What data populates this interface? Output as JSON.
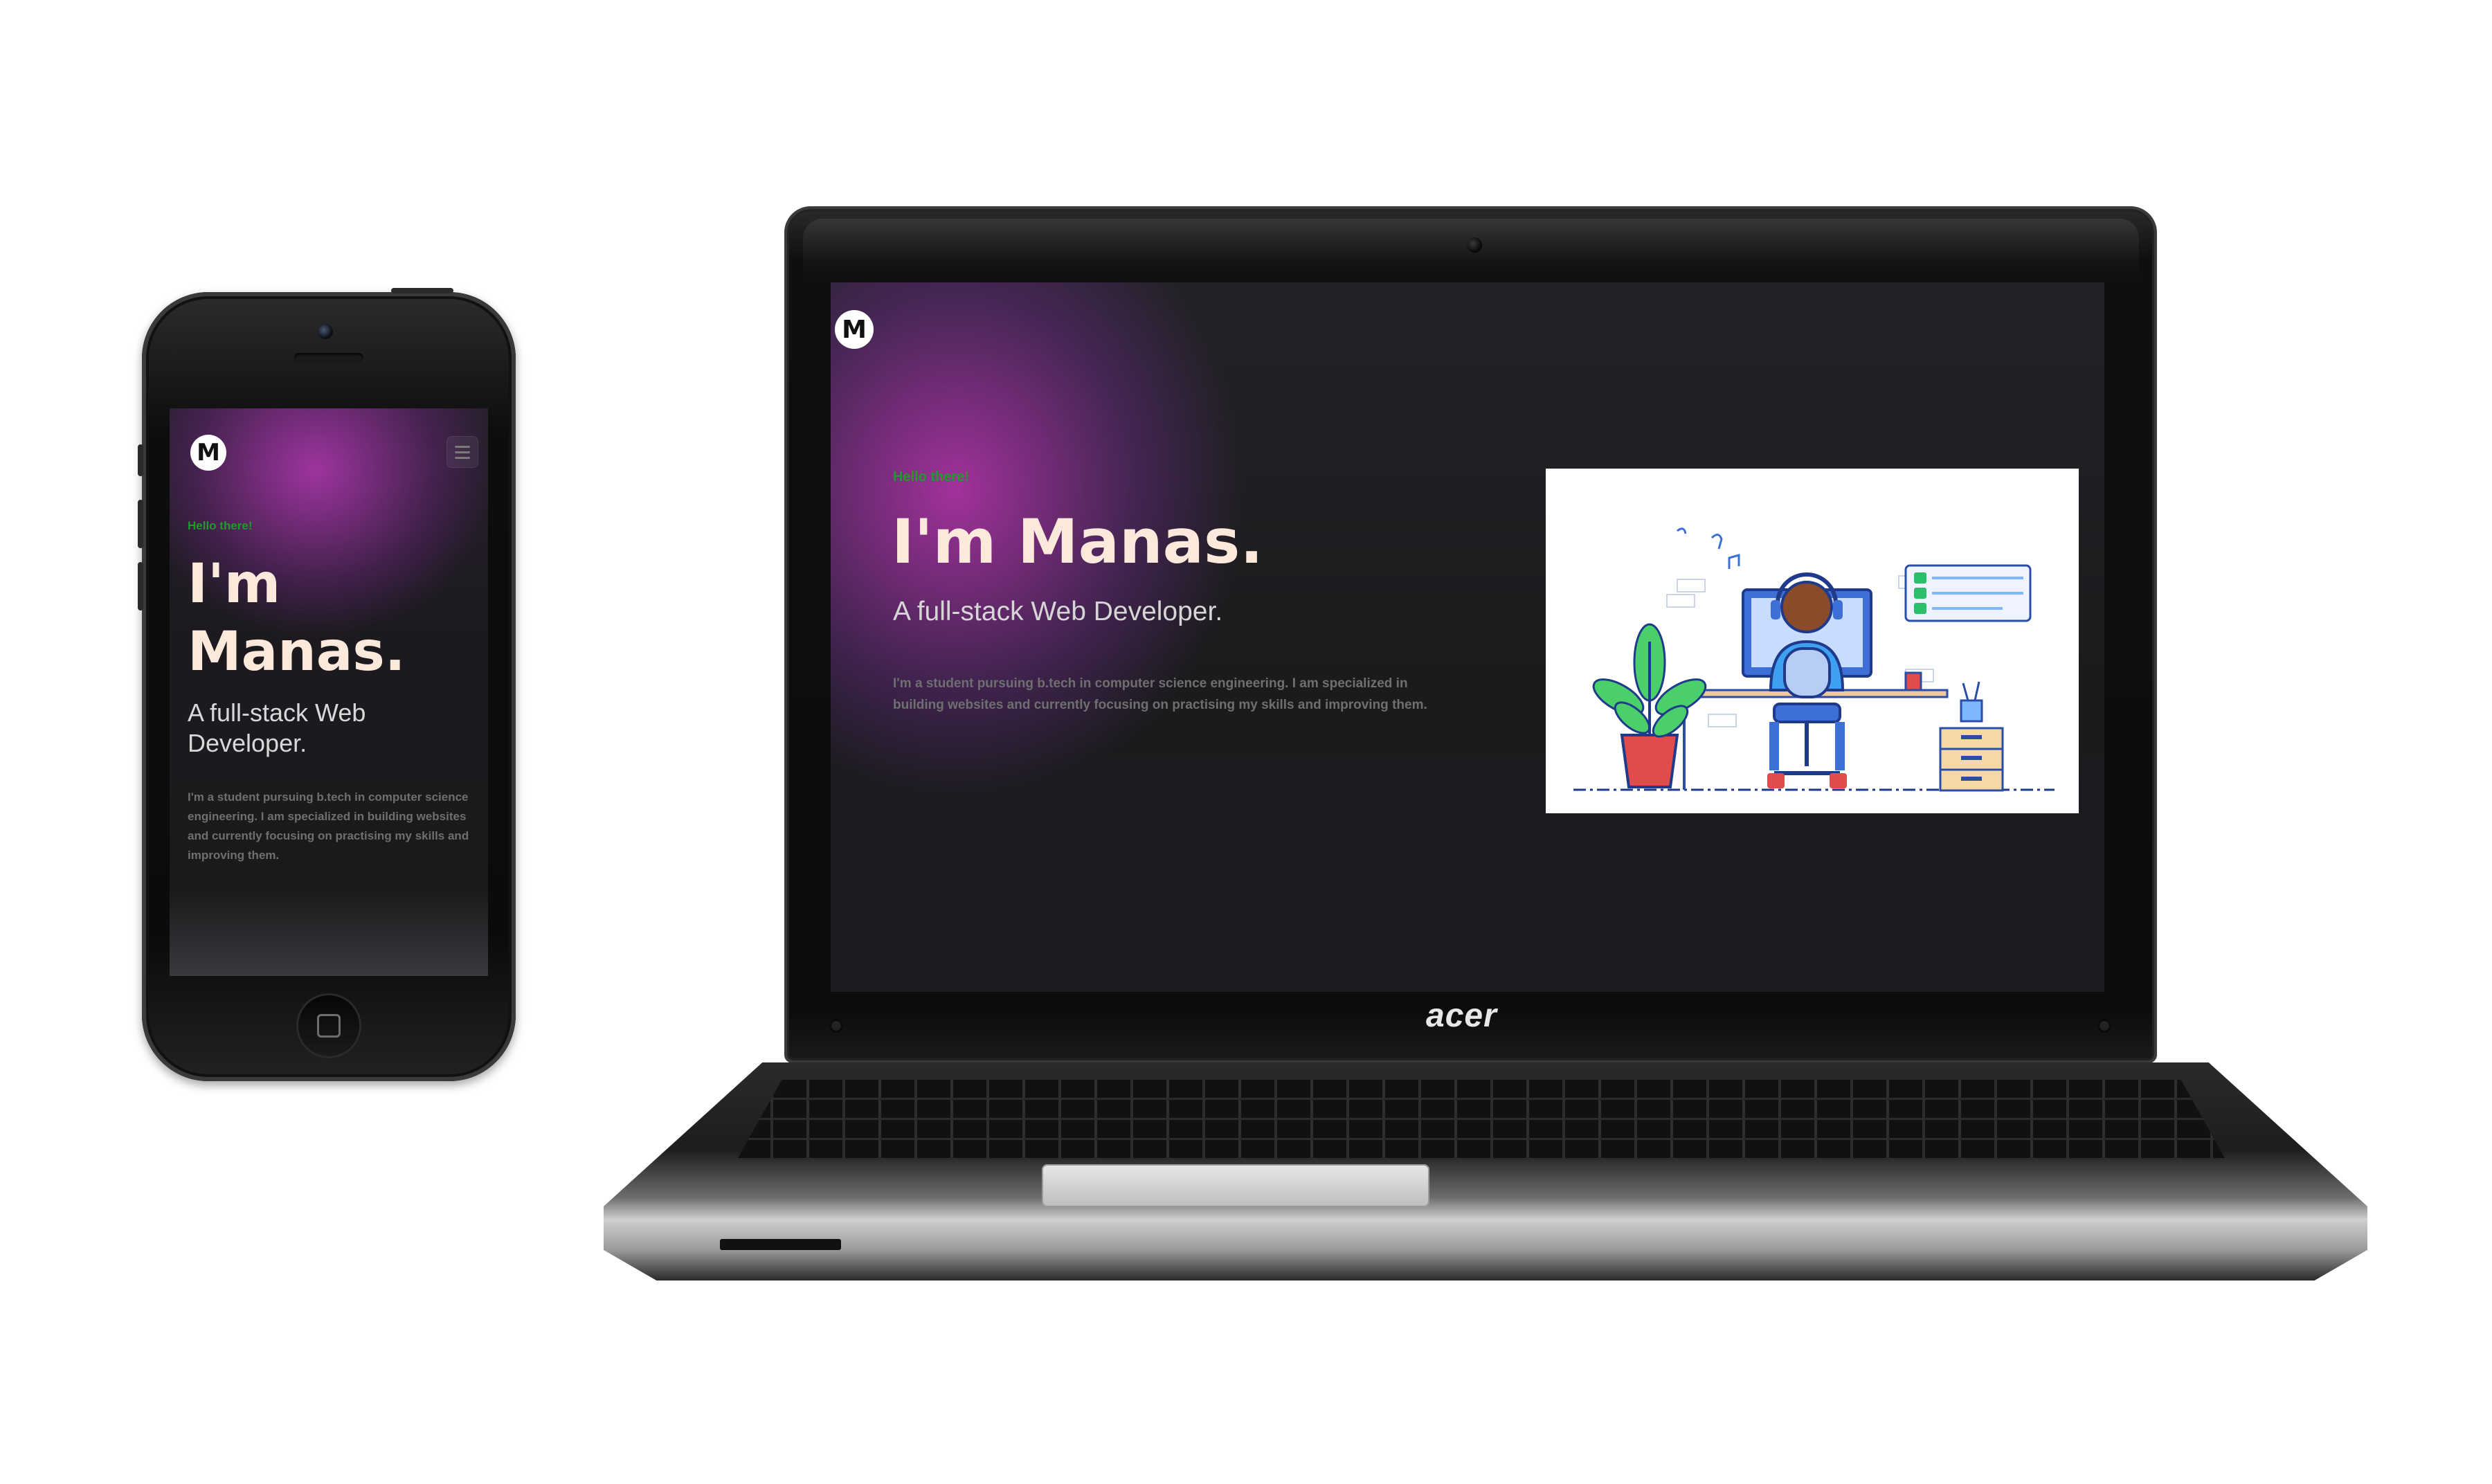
{
  "phone": {
    "logo": "M",
    "greeting": "Hello there!",
    "title_line1": "I'm",
    "title_line2": "Manas.",
    "subtitle": "A full-stack Web Developer.",
    "description": "I'm a student pursuing b.tech in computer science engineering. I am specialized in building websites and currently focusing on practising my skills and improving them."
  },
  "laptop": {
    "brand": "acer",
    "logo": "M",
    "greeting": "Hello there!",
    "title": "I'm Manas.",
    "subtitle": "A full-stack Web Developer.",
    "description": "I'm a student pursuing b.tech in computer science engineering. I am specialized in building websites and currently focusing on practising my skills and improving them."
  },
  "colors": {
    "page_bg": "#1b1b1d",
    "accent_glow": "#b034a8",
    "greeting": "#1f9a2b",
    "title": "#fbe9dc",
    "subtitle": "#d6d6d6",
    "body_text": "#6f6f6f"
  },
  "icons": [
    "logo-icon",
    "menu-icon",
    "developer-illustration"
  ]
}
